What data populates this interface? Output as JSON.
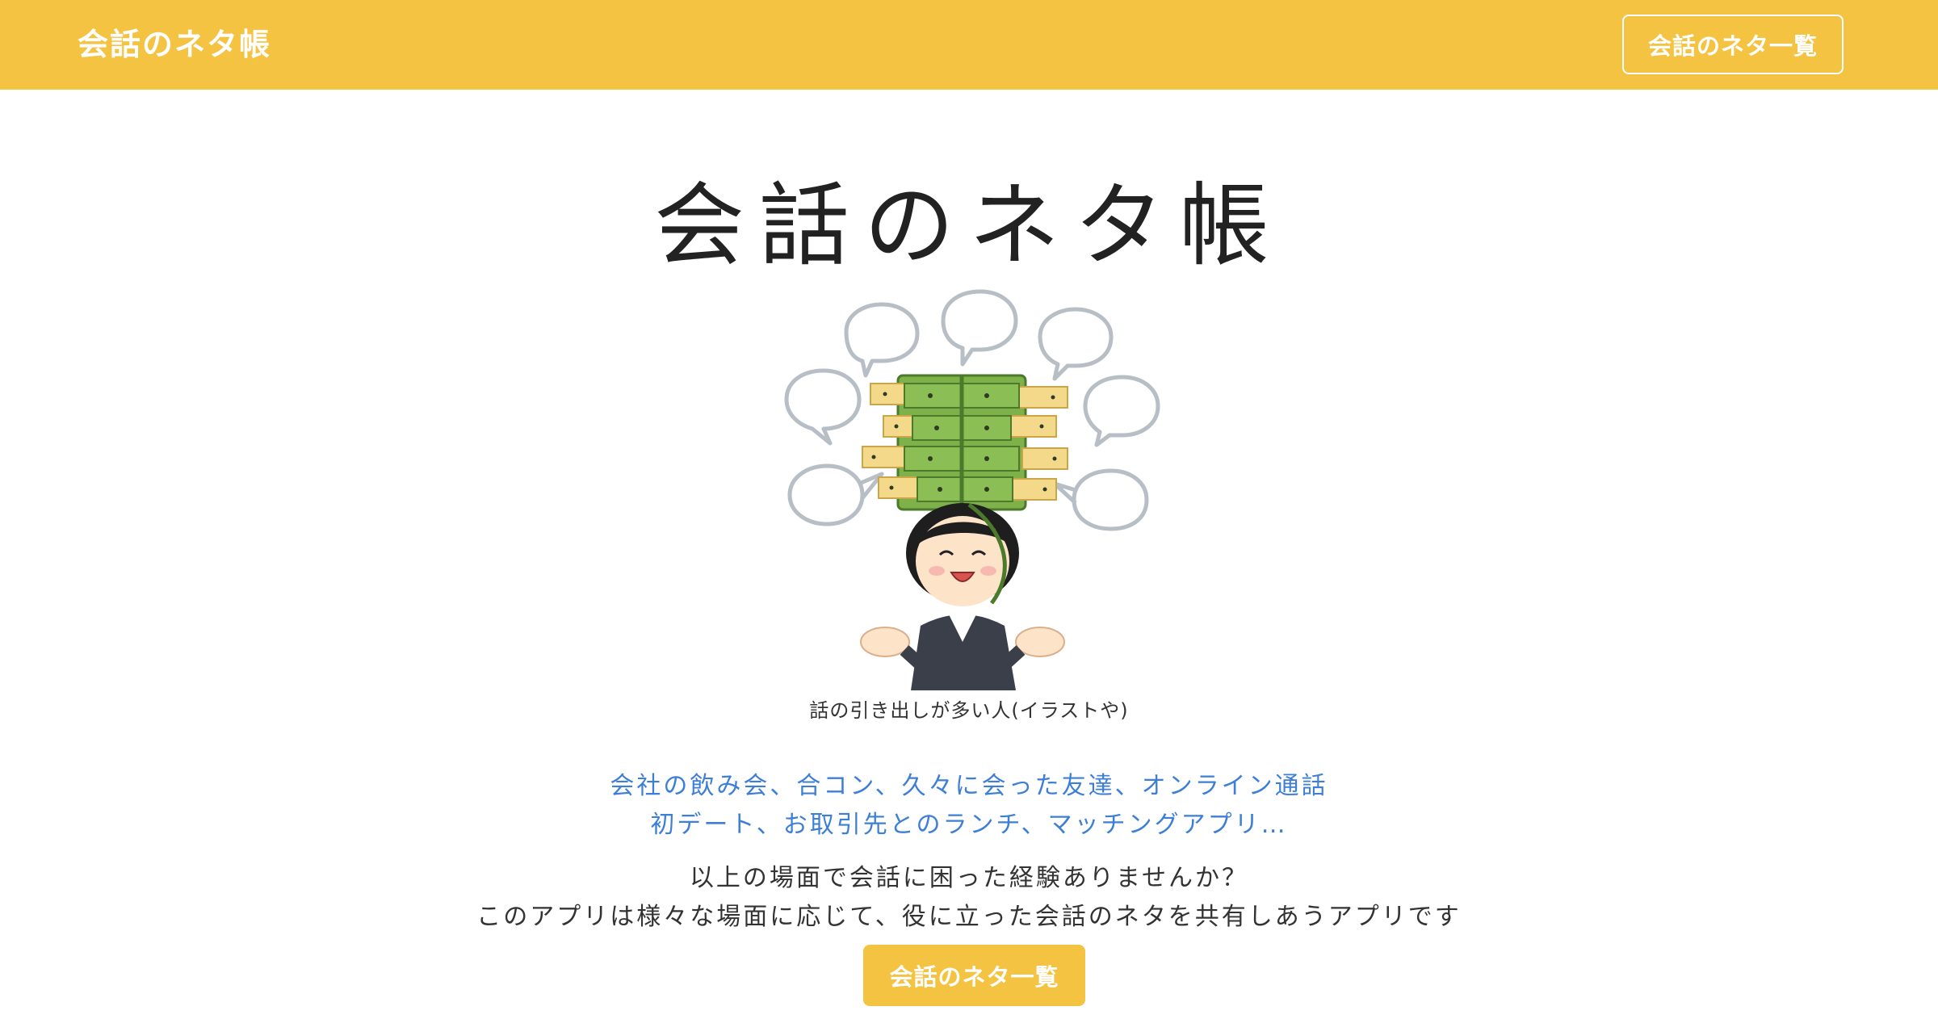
{
  "navbar": {
    "brand": "会話のネタ帳",
    "list_button": "会話のネタ一覧",
    "background_color": "#f5c342"
  },
  "hero": {
    "title": "会話のネタ帳",
    "illustration_icon": "person-with-drawers-and-speech-bubbles",
    "caption": "話の引き出しが多い人(イラストや)"
  },
  "scenes": {
    "line1": "会社の飲み会、合コン、久々に会った友達、オンライン通話",
    "line2": "初デート、お取引先とのランチ、マッチングアプリ…",
    "color": "#3d7fd6"
  },
  "description": {
    "line1": "以上の場面で会話に困った経験ありませんか？",
    "line2": "このアプリは様々な場面に応じて、役に立った会話のネタを共有しあうアプリです"
  },
  "cta": {
    "label": "会話のネタ一覧",
    "color": "#f5c342"
  }
}
